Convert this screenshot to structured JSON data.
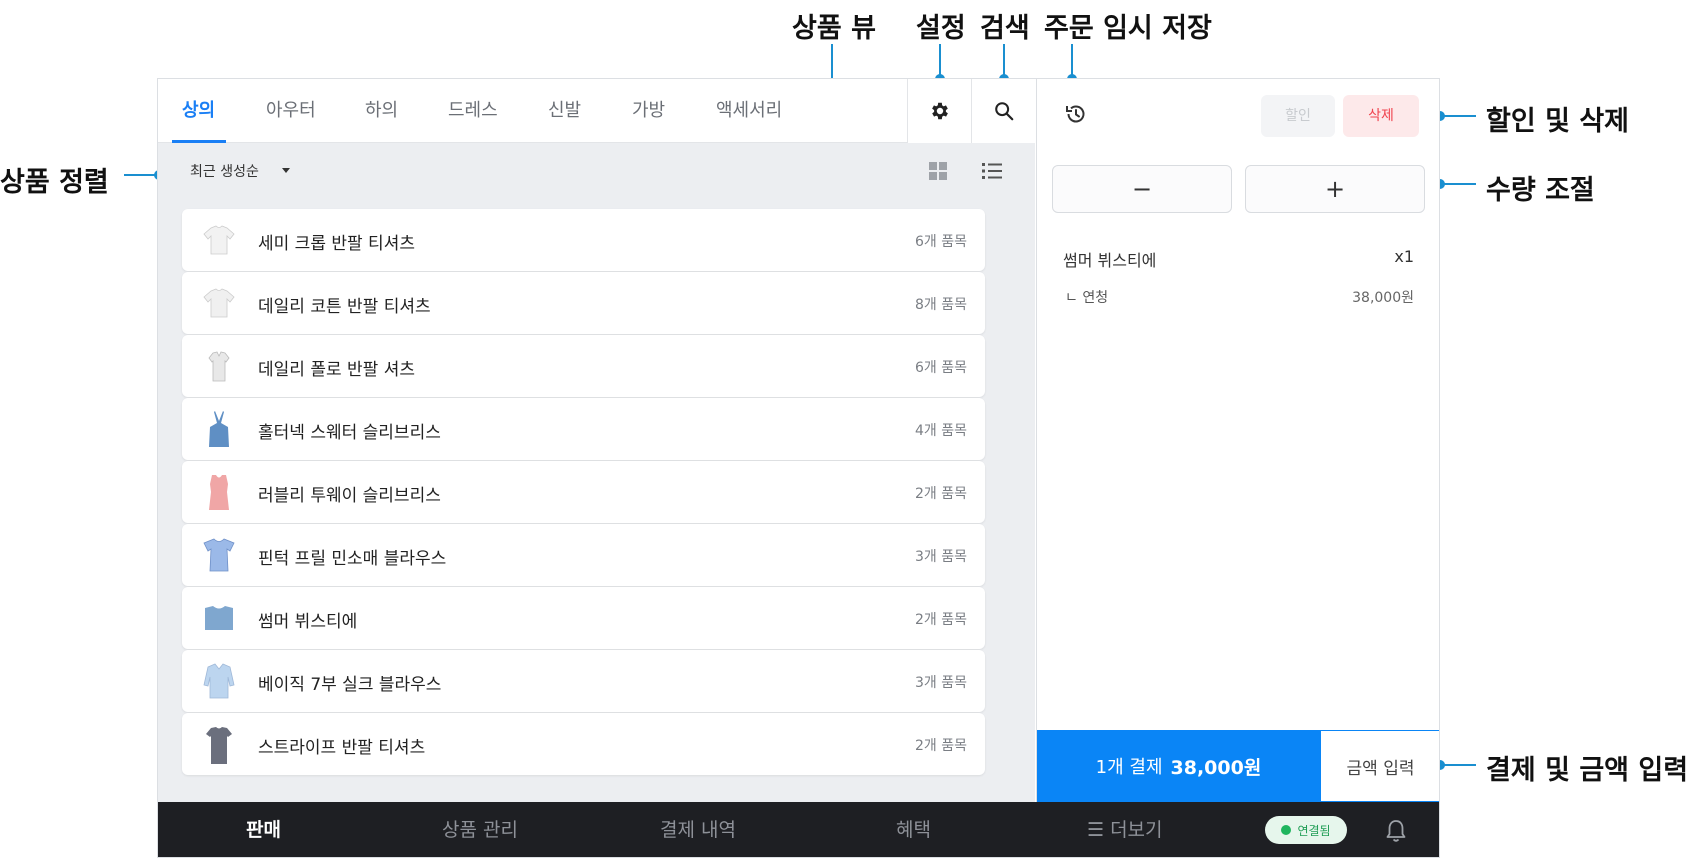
{
  "annotations": {
    "product_view": "상품 뷰",
    "settings": "설정",
    "search": "검색",
    "hold_order": "주문 임시 저장",
    "sort": "상품 정렬",
    "discount_delete": "할인 및 삭제",
    "quantity": "수량 조절",
    "payment": "결제 및 금액 입력"
  },
  "tabs": [
    "상의",
    "아우터",
    "하의",
    "드레스",
    "신발",
    "가방",
    "액세서리"
  ],
  "sort_label": "최근 생성순",
  "products": [
    {
      "name": "세미 크롭 반팔 티셔츠",
      "count": "6개 품목",
      "thumb_color": "#f2f2f2"
    },
    {
      "name": "데일리 코튼 반팔 티셔츠",
      "count": "8개 품목",
      "thumb_color": "#f0f0f0"
    },
    {
      "name": "데일리 폴로 반팔 셔츠",
      "count": "6개 품목",
      "thumb_color": "#e8e8e8"
    },
    {
      "name": "홀터넥 스웨터 슬리브리스",
      "count": "4개 품목",
      "thumb_color": "#5f8fc4"
    },
    {
      "name": "러블리 투웨이 슬리브리스",
      "count": "2개 품목",
      "thumb_color": "#f0a6a6"
    },
    {
      "name": "핀턱 프릴 민소매 블라우스",
      "count": "3개 품목",
      "thumb_color": "#9bb9e8"
    },
    {
      "name": "썸머 뷔스티에",
      "count": "2개 품목",
      "thumb_color": "#7fa7cf"
    },
    {
      "name": "베이직 7부 실크 블라우스",
      "count": "3개 품목",
      "thumb_color": "#bcd5ef"
    },
    {
      "name": "스트라이프 반팔 티셔츠",
      "count": "2개 품목",
      "thumb_color": "#6b6f7d"
    }
  ],
  "cart": {
    "discount_label": "할인",
    "delete_label": "삭제",
    "minus": "−",
    "plus": "+",
    "item_name": "썸머 뷔스티에",
    "item_qty": "x1",
    "option_name": "ㄴ 연청",
    "option_price": "38,000원",
    "pay_label": "1개 결제",
    "pay_amount": "38,000원",
    "amount_input_label": "금액 입력"
  },
  "bottom_nav": {
    "sell": "판매",
    "products": "상품 관리",
    "history": "결제 내역",
    "benefits": "혜택",
    "more": "☰ 더보기",
    "connected": "연결됨"
  },
  "colors": {
    "accent": "#1a7ff5",
    "pay": "#0a85f6",
    "delete": "#f0434e",
    "callout": "#1a8fd0",
    "nav_bg": "#1e1f23"
  }
}
